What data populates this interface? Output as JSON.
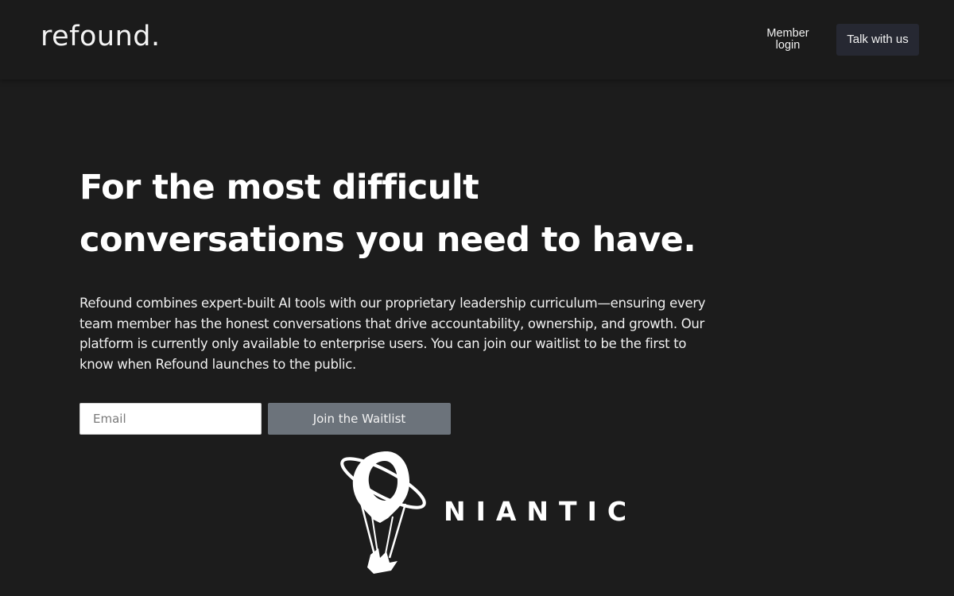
{
  "header": {
    "logo_text": "refound.",
    "member_login_label": "Member login",
    "talk_button_label": "Talk with us"
  },
  "hero": {
    "title_line1": "For the most difficult",
    "title_line2": "conversations you need to have.",
    "description": "Refound combines expert-built AI tools with our proprietary leadership curriculum—ensuring every team member has the honest conversations that drive accountability, ownership, and growth. Our platform is currently only available to enterprise users. You can join our waitlist to be the first to know when Refound launches to the public."
  },
  "waitlist_form": {
    "email_placeholder": "Email",
    "email_value": "",
    "submit_label": "Join the Waitlist"
  },
  "partner": {
    "name": "NIANTIC",
    "icon": "niantic-balloon-icon"
  },
  "colors": {
    "background": "#1c1c1c",
    "header_background": "#1b1b1b",
    "talk_button": "#262832",
    "waitlist_button": "#6c737b",
    "text": "#ffffff"
  }
}
